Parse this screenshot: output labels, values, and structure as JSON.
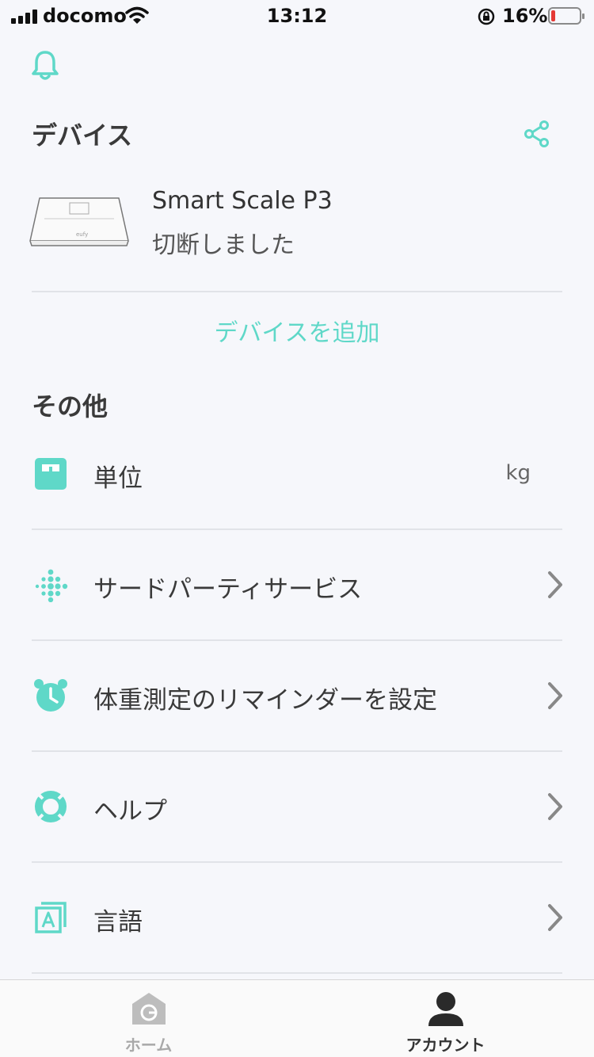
{
  "status_bar": {
    "carrier": "docomo",
    "time": "13:12",
    "battery_percent": "16%",
    "battery_level": 0.16
  },
  "colors": {
    "accent": "#5fd8c8",
    "background": "#f6f7fb",
    "battery_low": "#e53935"
  },
  "devices_section": {
    "title": "デバイス",
    "devices": [
      {
        "name": "Smart Scale P3",
        "status": "切断しました"
      }
    ],
    "add_device_label": "デバイスを追加"
  },
  "other_section": {
    "title": "その他",
    "items": [
      {
        "icon": "scale-unit-icon",
        "label": "単位",
        "value": "kg"
      },
      {
        "icon": "fitbit-icon",
        "label": "サードパーティサービス"
      },
      {
        "icon": "alarm-clock-icon",
        "label": "体重測定のリマインダーを設定"
      },
      {
        "icon": "lifebuoy-icon",
        "label": "ヘルプ"
      },
      {
        "icon": "language-icon",
        "label": "言語"
      }
    ]
  },
  "tab_bar": {
    "home_label": "ホーム",
    "account_label": "アカウント",
    "active": "account"
  }
}
